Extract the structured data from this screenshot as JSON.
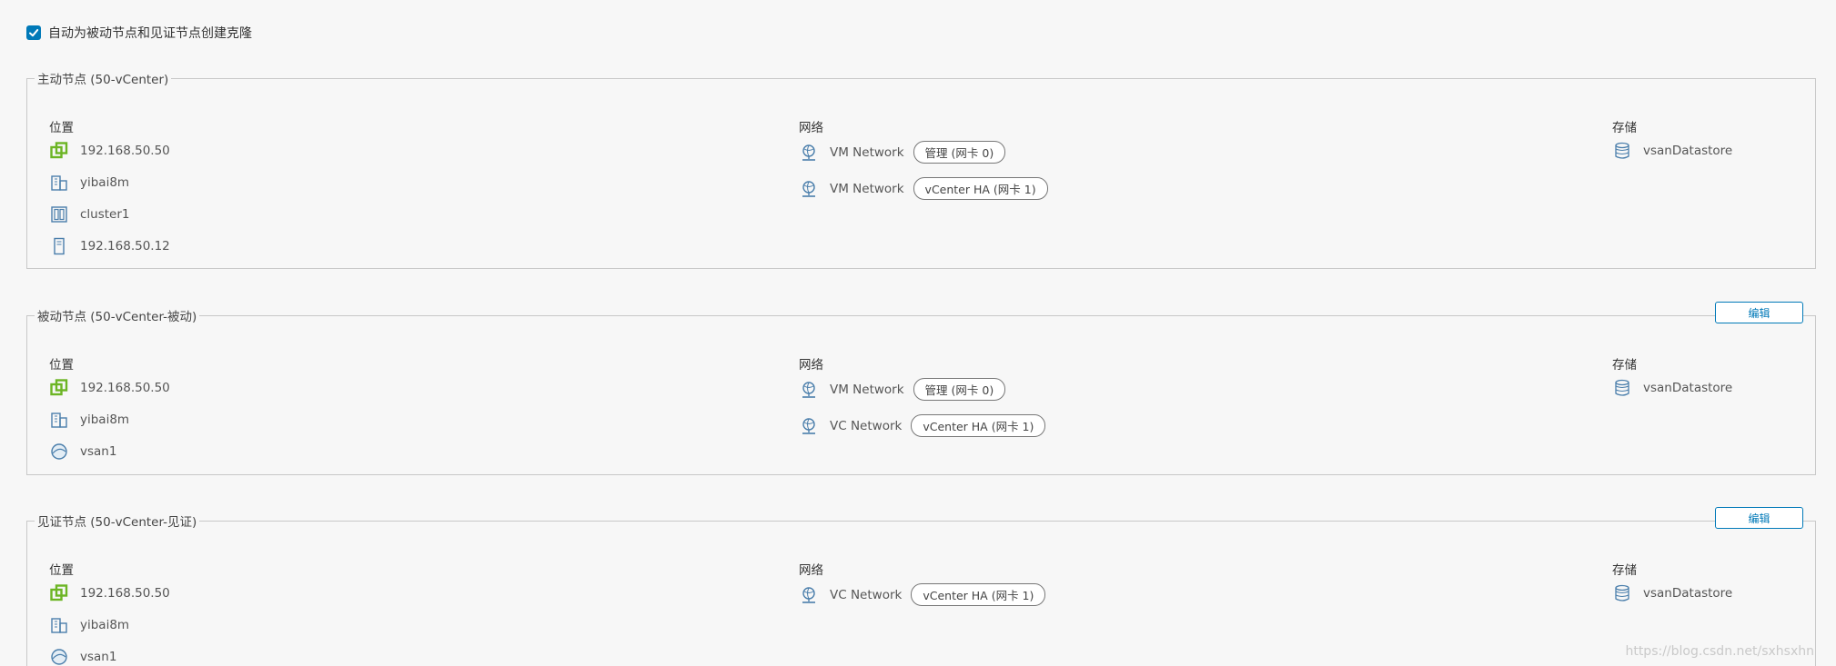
{
  "clone_checkbox": {
    "label": "自动为被动节点和见证节点创建克隆",
    "checked": true
  },
  "column_titles": {
    "location": "位置",
    "network": "网络",
    "storage": "存储"
  },
  "edit_label": "编辑",
  "nodes": [
    {
      "title": "主动节点 (50-vCenter)",
      "location": [
        "192.168.50.50",
        "yibai8m",
        "cluster1",
        "192.168.50.12"
      ],
      "network": [
        {
          "name": "VM Network",
          "tag": "管理 (网卡 0)"
        },
        {
          "name": "VM Network",
          "tag": "vCenter HA (网卡 1)"
        }
      ],
      "storage": "vsanDatastore"
    },
    {
      "title": "被动节点 (50-vCenter-被动)",
      "location": [
        "192.168.50.50",
        "yibai8m",
        "vsan1"
      ],
      "network": [
        {
          "name": "VM Network",
          "tag": "管理 (网卡 0)"
        },
        {
          "name": "VC Network",
          "tag": "vCenter HA (网卡 1)"
        }
      ],
      "storage": "vsanDatastore"
    },
    {
      "title": "见证节点 (50-vCenter-见证)",
      "location": [
        "192.168.50.50",
        "yibai8m",
        "vsan1"
      ],
      "network": [
        {
          "name": "VC Network",
          "tag": "vCenter HA (网卡 1)"
        }
      ],
      "storage": "vsanDatastore"
    }
  ],
  "watermark": "https://blog.csdn.net/sxhsxhn",
  "icons": {
    "vcenter": "vcenter-host-icon",
    "datacenter": "datacenter-icon",
    "cluster": "cluster-icon",
    "host": "host-icon",
    "vsan": "vsan-icon",
    "network": "network-icon",
    "datastore": "datastore-icon"
  },
  "colors": {
    "accent": "#0079b8",
    "vcenter_green": "#6cb524",
    "icon_blue": "#4a7eab"
  }
}
